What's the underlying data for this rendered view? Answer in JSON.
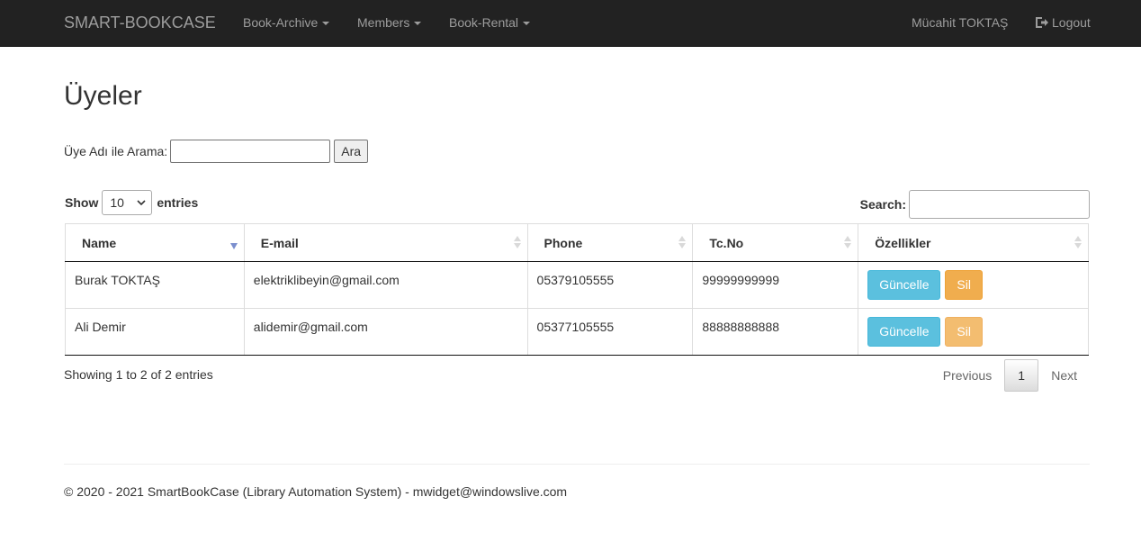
{
  "navbar": {
    "brand": "SMART-BOOKCASE",
    "menus": [
      {
        "label": "Book-Archive"
      },
      {
        "label": "Members"
      },
      {
        "label": "Book-Rental"
      }
    ],
    "user": "Mücahit TOKTAŞ",
    "logout": "Logout"
  },
  "page": {
    "title": "Üyeler",
    "search_label": "Üye Adı ile Arama:",
    "search_button": "Ara"
  },
  "table": {
    "length_show": "Show",
    "length_value": "10",
    "length_entries": "entries",
    "filter_label": "Search:",
    "columns": [
      "Name",
      "E-mail",
      "Phone",
      "Tc.No",
      "Özellikler"
    ],
    "rows": [
      {
        "name": "Burak TOKTAŞ",
        "email": "elektriklibeyin@gmail.com",
        "phone": "05379105555",
        "tc": "99999999999",
        "update": "Güncelle",
        "delete": "Sil"
      },
      {
        "name": "Ali Demir",
        "email": "alidemir@gmail.com",
        "phone": "05377105555",
        "tc": "88888888888",
        "update": "Güncelle",
        "delete": "Sil"
      }
    ],
    "info": "Showing 1 to 2 of 2 entries",
    "previous": "Previous",
    "current_page": "1",
    "next": "Next"
  },
  "footer": {
    "text": "© 2020 - 2021 SmartBookCase (Library Automation System) - mwidget@windowslive.com"
  },
  "colors": {
    "navbar_bg": "#222222",
    "info_button": "#5bc0de",
    "warning_button": "#f0ad4e"
  }
}
